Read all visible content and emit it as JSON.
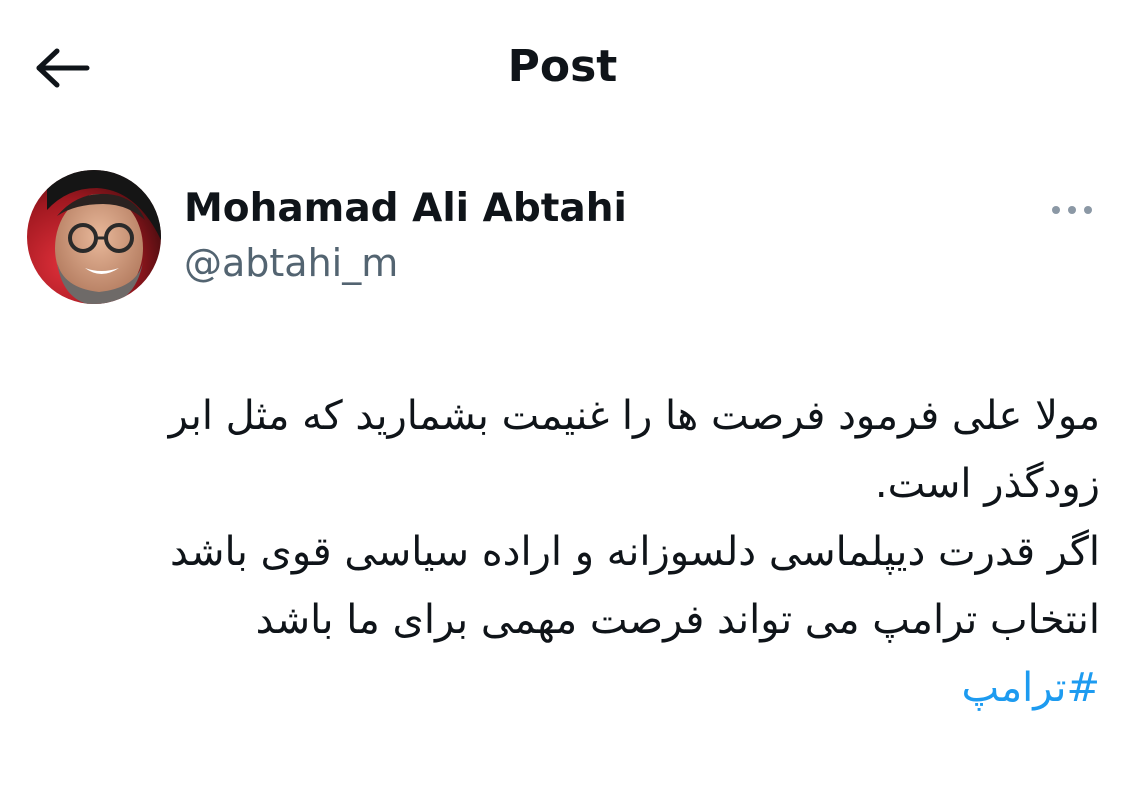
{
  "header": {
    "title": "Post",
    "back_icon": "arrow-left-icon"
  },
  "author": {
    "display_name": "Mohamad Ali Abtahi",
    "handle": "@abtahi_m",
    "more_icon": "more-horizontal-icon"
  },
  "tweet": {
    "lines": [
      "مولا علی فرمود فرصت ها را غنیمت بشمارید که مثل ابر",
      "زودگذر است.",
      "اگر قدرت دیپلماسی دلسوزانه و اراده سیاسی قوی باشد",
      "انتخاب ترامپ می تواند فرصت مهمی برای ما باشد"
    ],
    "hashtag": "#ترامپ"
  },
  "colors": {
    "text": "#0f1419",
    "secondary": "#536471",
    "link": "#1d9bf0",
    "background": "#ffffff"
  }
}
